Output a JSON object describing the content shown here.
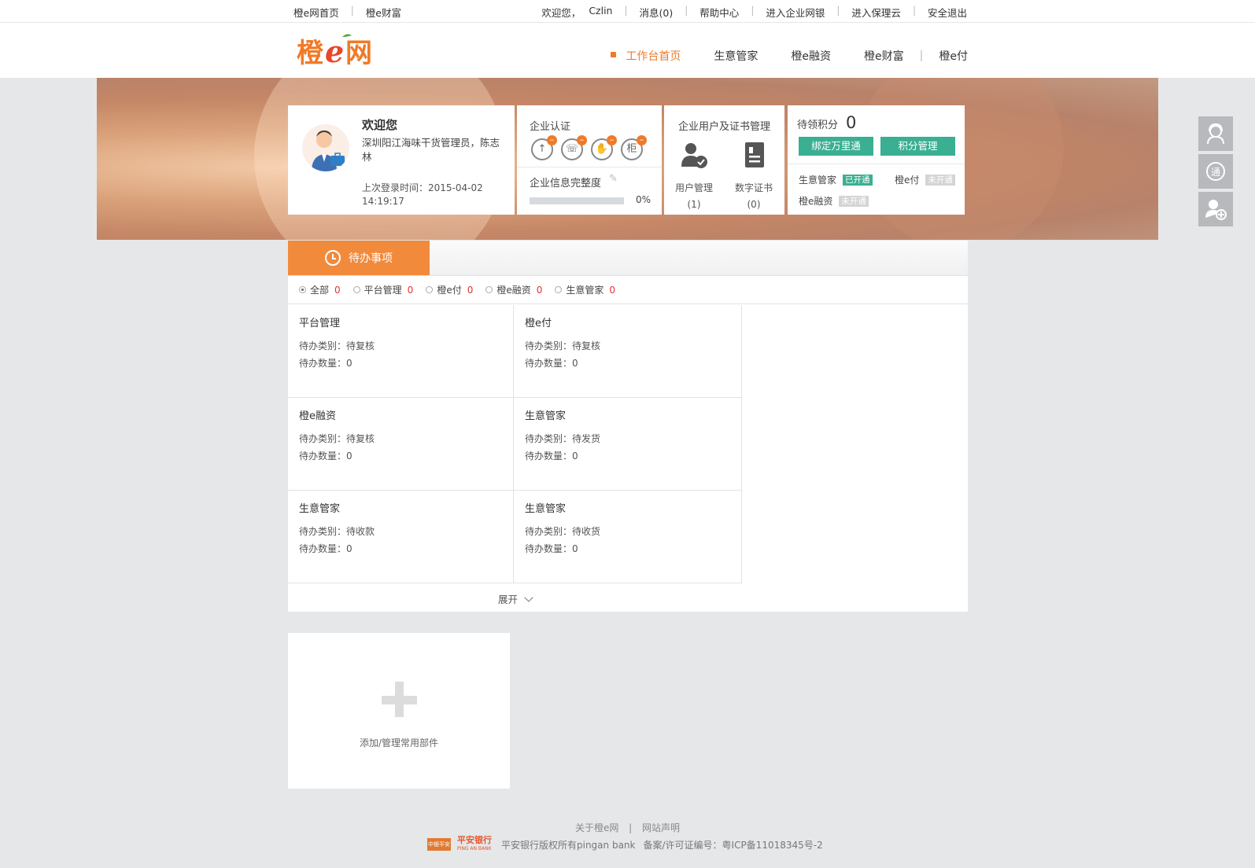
{
  "topbar": {
    "home_link": "橙e网首页",
    "wealth_link": "橙e财富",
    "welcome_text": "欢迎您，",
    "username": "Czlin",
    "messages": "消息(0)",
    "help": "帮助中心",
    "enterprise_bank": "进入企业网银",
    "factoring_cloud": "进入保理云",
    "logout": "安全退出"
  },
  "header": {
    "logo_text": "橙e网",
    "nav": [
      "工作台首页",
      "生意管家",
      "橙e融资",
      "橙e财富",
      "橙e付"
    ]
  },
  "welcome_card": {
    "title": "欢迎您",
    "company": "深圳阳江海味干货管理员，陈志林",
    "last_login": "上次登录时间：2015-04-02 14:19:17"
  },
  "cert_card": {
    "title": "企业认证",
    "info_label": "企业信息完整度",
    "progress_percent": "0%",
    "icons": [
      "upload-cert-icon",
      "phone-cert-icon",
      "hand-cert-icon",
      "counter-cert-icon"
    ]
  },
  "user_card": {
    "title": "企业用户及证书管理",
    "user_mgmt": "用户管理",
    "user_count": "(1)",
    "cert": "数字证书",
    "cert_count": "(0)"
  },
  "points_card": {
    "label": "待领积分",
    "points": "0",
    "bind_button": "绑定万里通",
    "manage_button": "积分管理",
    "services": [
      {
        "name": "生意管家",
        "status": "已开通"
      },
      {
        "name": "橙e付",
        "status": "未开通"
      },
      {
        "name": "橙e融资",
        "status": "未开通"
      }
    ]
  },
  "todo": {
    "tab_label": "待办事项",
    "filters": [
      {
        "label": "全部",
        "count": "0"
      },
      {
        "label": "平台管理",
        "count": "0"
      },
      {
        "label": "橙e付",
        "count": "0"
      },
      {
        "label": "橙e融资",
        "count": "0"
      },
      {
        "label": "生意管家",
        "count": "0"
      }
    ],
    "items": [
      {
        "name": "平台管理",
        "type": "待办类别：待复核",
        "count": "待办数量：0"
      },
      {
        "name": "橙e付",
        "type": "待办类别：待复核",
        "count": "待办数量：0"
      },
      {
        "name": "橙e融资",
        "type": "待办类别：待复核",
        "count": "待办数量：0"
      },
      {
        "name": "生意管家",
        "type": "待办类别：待发货",
        "count": "待办数量：0"
      },
      {
        "name": "生意管家",
        "type": "待办类别：待收款",
        "count": "待办数量：0"
      },
      {
        "name": "生意管家",
        "type": "待办类别：待收货",
        "count": "待办数量：0"
      }
    ],
    "expand": "展开"
  },
  "widget": {
    "add_label": "添加/管理常用部件"
  },
  "footer": {
    "about": "关于橙e网",
    "statement": "网站声明",
    "copyright": "平安银行版权所有pingan bank",
    "icp": "备案/许可证编号：粤ICP备11018345号-2",
    "bank_name": "平安银行",
    "bank_en": "PING AN BANK",
    "partner_logo": "中银平安"
  },
  "colors": {
    "accent_orange": "#f07a28",
    "green_button": "#3aaf92",
    "alert_red": "#e3342f"
  }
}
